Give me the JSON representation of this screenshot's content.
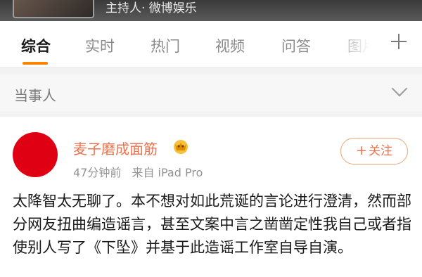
{
  "banner": {
    "caption": "主持人· 微博娱乐"
  },
  "tabs": {
    "items": [
      {
        "label": "综合",
        "active": true
      },
      {
        "label": "实时",
        "active": false
      },
      {
        "label": "热门",
        "active": false
      },
      {
        "label": "视频",
        "active": false
      },
      {
        "label": "问答",
        "active": false
      },
      {
        "label": "图片",
        "active": false
      }
    ],
    "accent_color": "#ff8200",
    "add_icon": "plus-icon"
  },
  "filter": {
    "label": "当事人",
    "icon": "chevron-down-icon"
  },
  "post": {
    "author": "麦子磨成面筋",
    "badge_icon": "vip-crown-icon",
    "time": "47分钟前",
    "source": "来自 iPad Pro",
    "follow_label": "关注",
    "follow_icon": "plus-icon",
    "avatar_color": "#e00014",
    "name_color": "#eb7350",
    "text": "太降智太无聊了。本不想对如此荒诞的言论进行澄清，然而部分网友扭曲编造谣言，甚至文案中言之凿凿定性我自己或者指使别人写了《下坠》并基于此造谣工作室自导自演。"
  }
}
